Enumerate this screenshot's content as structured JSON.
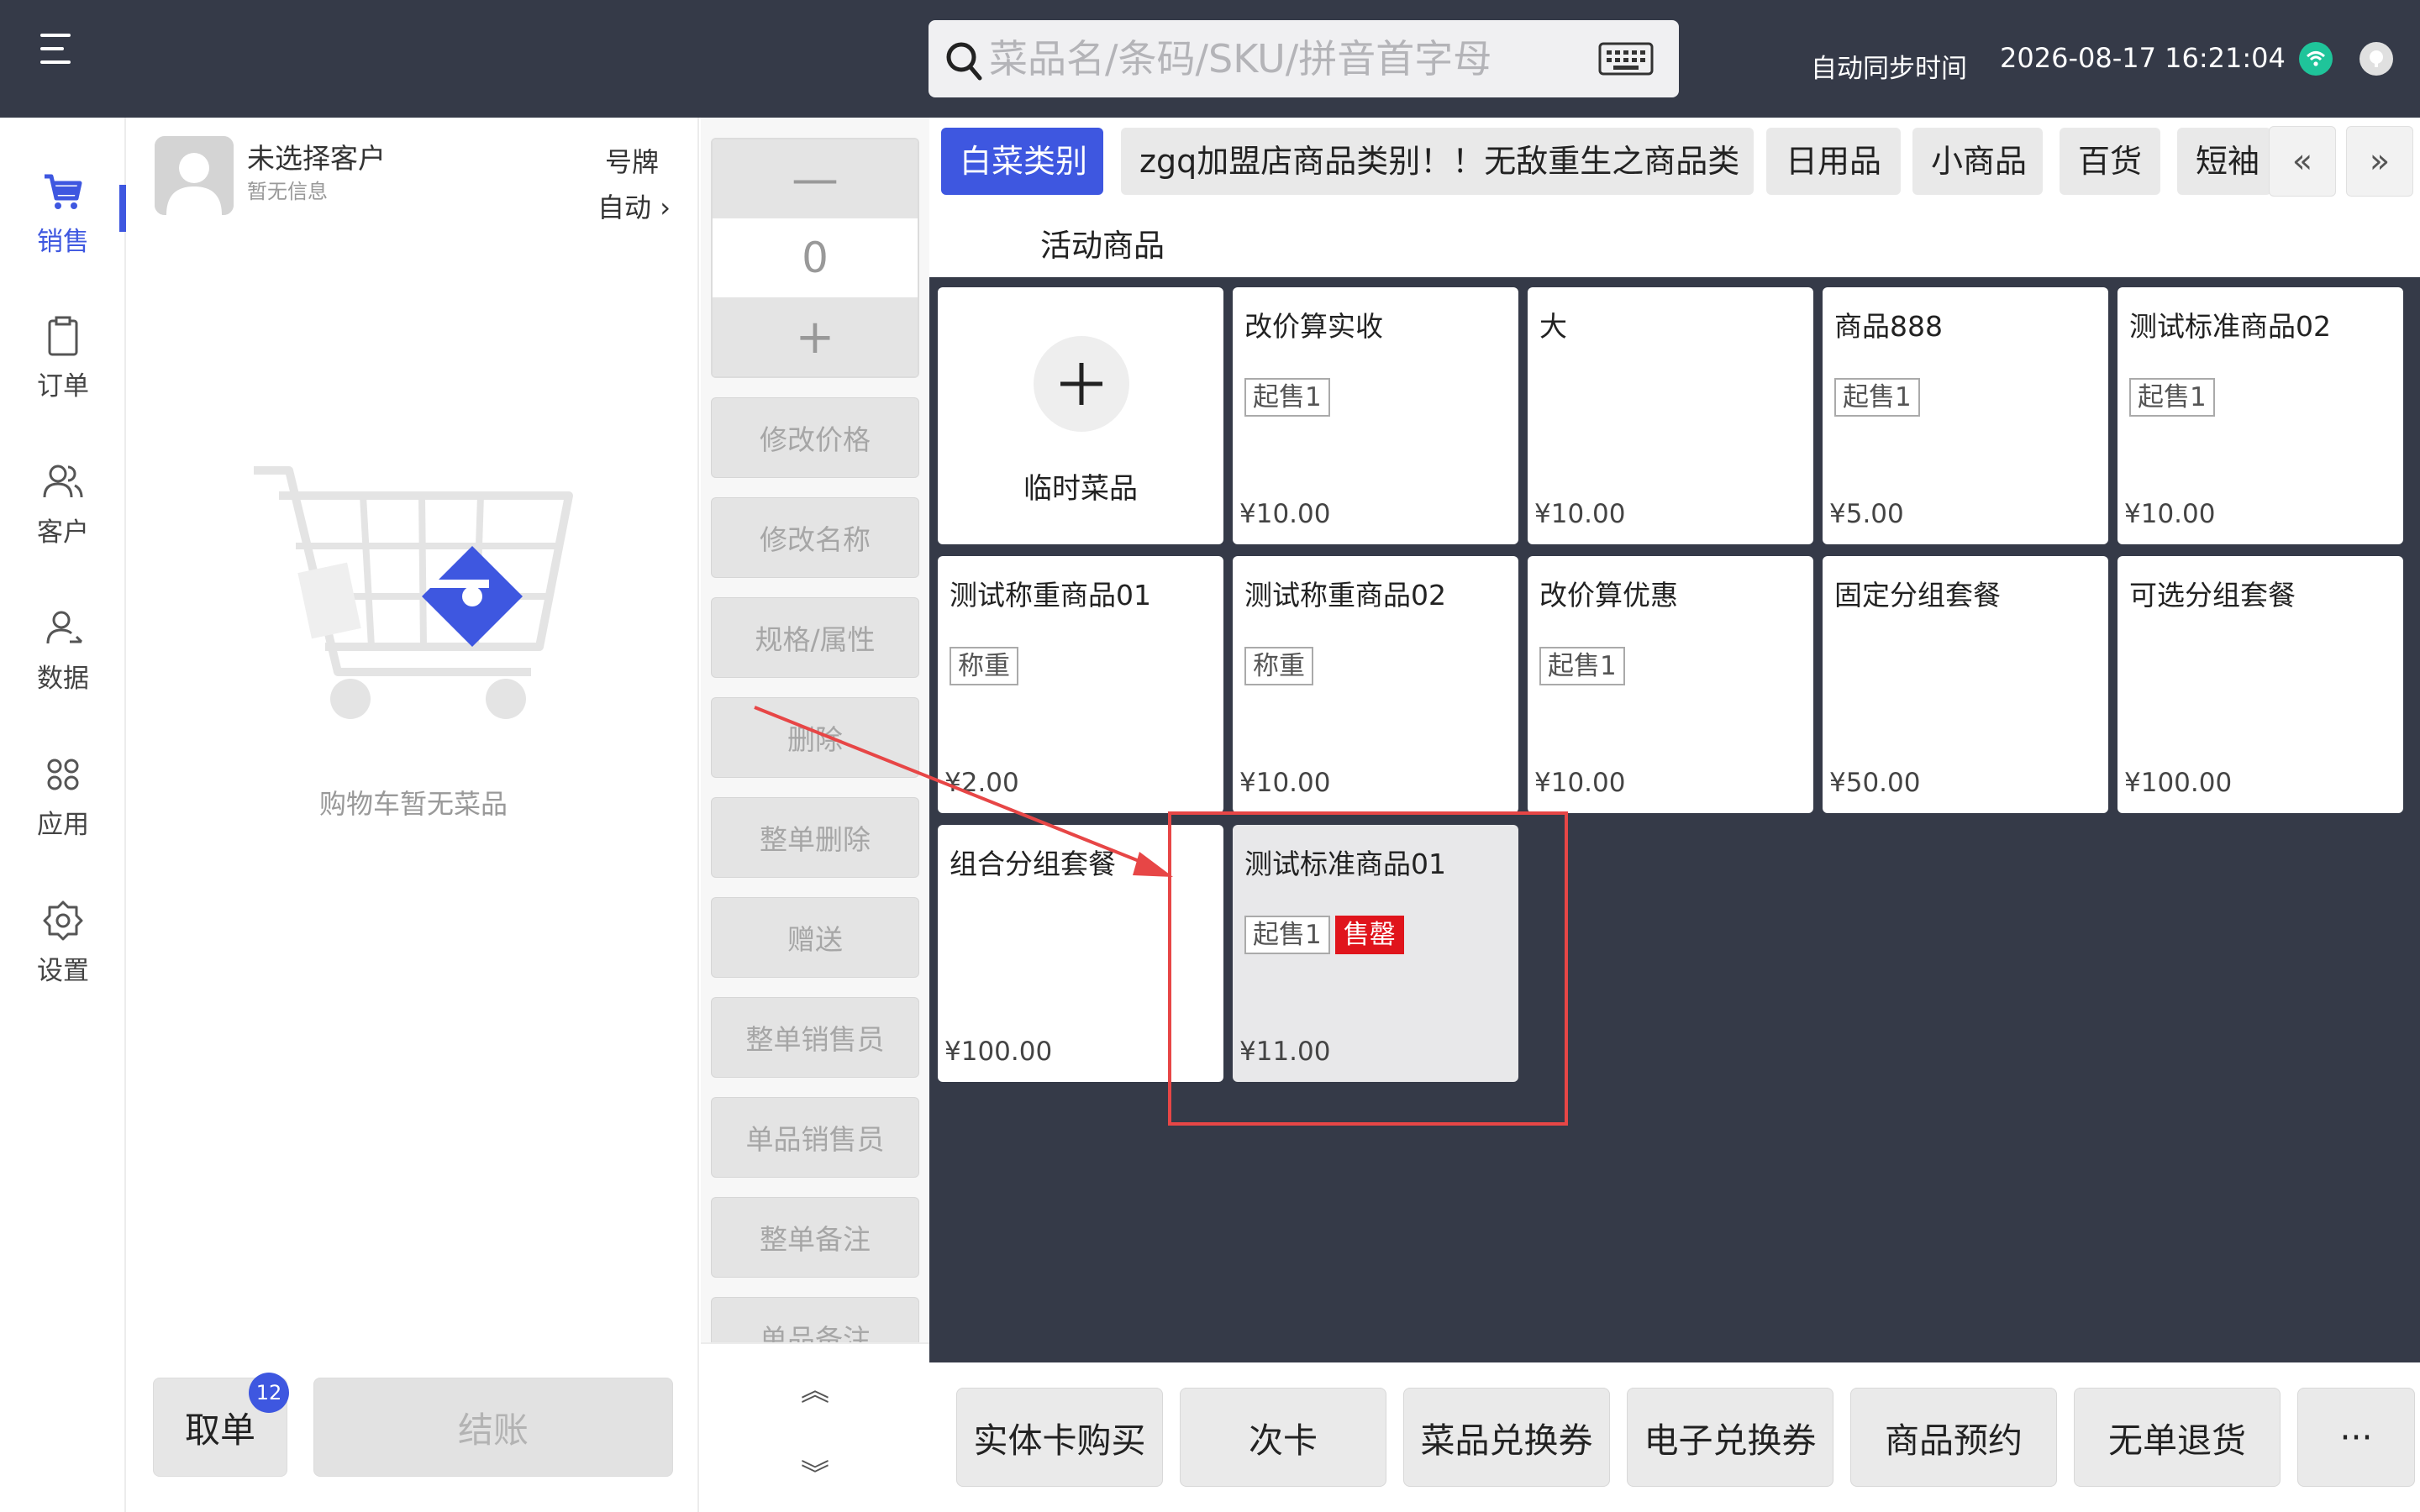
{
  "topbar": {
    "search_placeholder": "菜品名/条码/SKU/拼音首字母",
    "sync_label": "自动同步时间",
    "datetime": "2026-08-17 16:21:04"
  },
  "nav": {
    "items": [
      {
        "label": "销售",
        "icon": "cart-icon",
        "active": true
      },
      {
        "label": "订单",
        "icon": "clipboard-icon"
      },
      {
        "label": "客户",
        "icon": "users-icon"
      },
      {
        "label": "数据",
        "icon": "user-data-icon"
      },
      {
        "label": "应用",
        "icon": "apps-icon"
      },
      {
        "label": "设置",
        "icon": "gear-icon"
      }
    ]
  },
  "cart": {
    "customer_name": "未选择客户",
    "customer_info": "暂无信息",
    "tag_label": "号牌",
    "tag_value": "自动 ›",
    "empty_text": "购物车暂无菜品",
    "cancel_label": "取单",
    "cancel_badge": "12",
    "checkout_label": "结账"
  },
  "actions": {
    "minus": "—",
    "quantity": "0",
    "plus": "+",
    "buttons": [
      "修改价格",
      "修改名称",
      "规格/属性",
      "删除",
      "整单删除",
      "赠送",
      "整单销售员",
      "单品销售员",
      "整单备注",
      "单品备注"
    ],
    "scroll_up": "︽",
    "scroll_down": "︾"
  },
  "categories": {
    "tabs": [
      "白菜类别",
      "zgq加盟店商品类别！！无敌重生之商品类",
      "日用品",
      "小商品",
      "百货",
      "短袖"
    ],
    "prev": "«",
    "next": "»",
    "sub_label": "活动商品"
  },
  "products": {
    "temp": {
      "name": "临时菜品",
      "plus": "+"
    },
    "items": [
      {
        "name": "改价算实收",
        "tags": [
          "起售1"
        ],
        "price": "¥10.00"
      },
      {
        "name": "大",
        "tags": [],
        "price": "¥10.00"
      },
      {
        "name": "商品888",
        "tags": [
          "起售1"
        ],
        "price": "¥5.00"
      },
      {
        "name": "测试标准商品02",
        "tags": [
          "起售1"
        ],
        "price": "¥10.00"
      },
      {
        "name": "测试称重商品01",
        "tags": [
          "称重"
        ],
        "price": "¥2.00"
      },
      {
        "name": "测试称重商品02",
        "tags": [
          "称重"
        ],
        "price": "¥10.00"
      },
      {
        "name": "改价算优惠",
        "tags": [
          "起售1"
        ],
        "price": "¥10.00"
      },
      {
        "name": "固定分组套餐",
        "tags": [],
        "price": "¥50.00"
      },
      {
        "name": "可选分组套餐",
        "tags": [],
        "price": "¥100.00"
      },
      {
        "name": "组合分组套餐",
        "tags": [],
        "price": "¥100.00"
      },
      {
        "name": "测试标准商品01",
        "tags": [
          "起售1"
        ],
        "sold_out": "售罄",
        "price": "¥11.00",
        "disabled": true
      }
    ]
  },
  "bottom": {
    "buttons": [
      "实体卡购买",
      "次卡",
      "菜品兑换券",
      "电子兑换券",
      "商品预约",
      "无单退货"
    ],
    "more": "···"
  },
  "colors": {
    "accent": "#3e57e0",
    "dark": "#353a48",
    "sold_out": "#e0141c",
    "highlight": "#e74646"
  }
}
